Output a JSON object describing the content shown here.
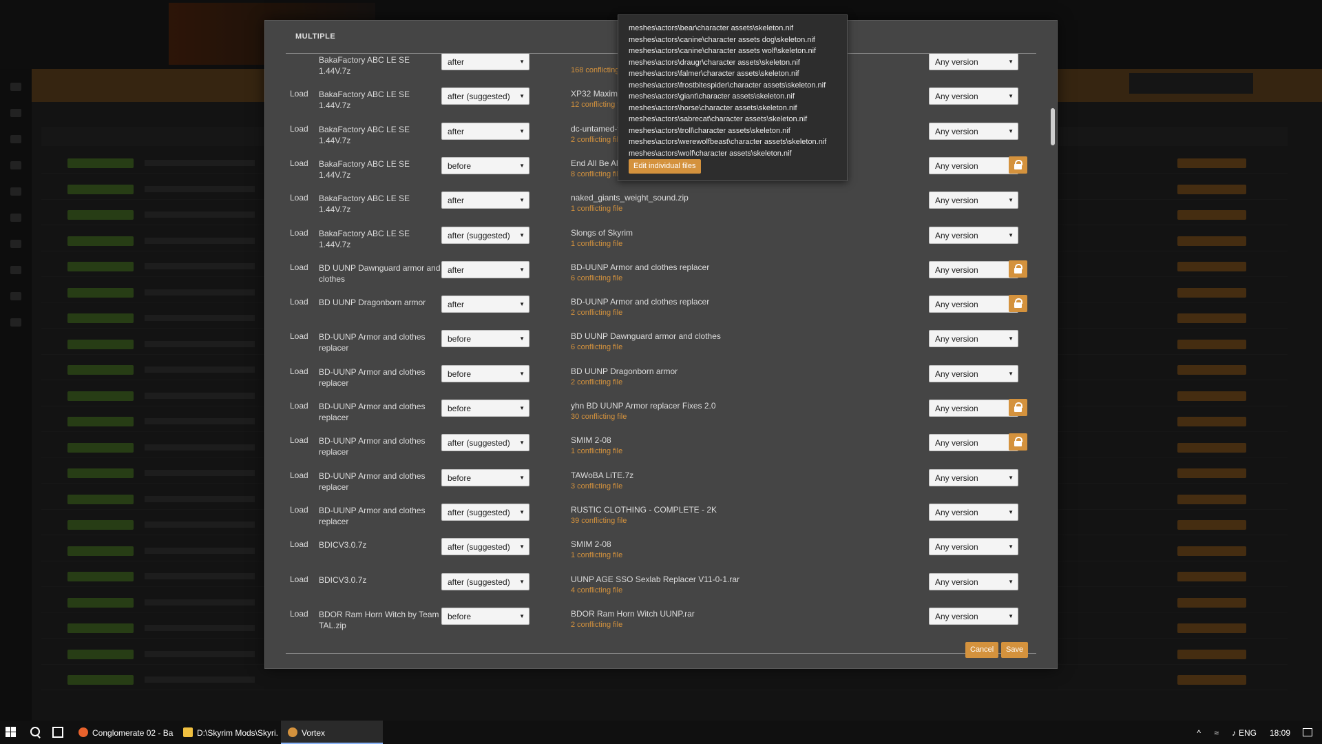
{
  "dialog": {
    "title": "MULTIPLE",
    "cancel_label": "Cancel",
    "save_label": "Save"
  },
  "popover": {
    "files": [
      "meshes\\actors\\bear\\character assets\\skeleton.nif",
      "meshes\\actors\\canine\\character assets dog\\skeleton.nif",
      "meshes\\actors\\canine\\character assets wolf\\skeleton.nif",
      "meshes\\actors\\draugr\\character assets\\skeleton.nif",
      "meshes\\actors\\falmer\\character assets\\skeleton.nif",
      "meshes\\actors\\frostbitespider\\character assets\\skeleton.nif",
      "meshes\\actors\\giant\\character assets\\skeleton.nif",
      "meshes\\actors\\horse\\character assets\\skeleton.nif",
      "meshes\\actors\\sabrecat\\character assets\\skeleton.nif",
      "meshes\\actors\\troll\\character assets\\skeleton.nif",
      "meshes\\actors\\werewolfbeast\\character assets\\skeleton.nif",
      "meshes\\actors\\wolf\\character assets\\skeleton.nif"
    ],
    "edit_label": "Edit individual files"
  },
  "rules": [
    {
      "type": "",
      "source": "BakaFactory ABC LE SE 1.44V.7z",
      "relation": "after",
      "target": "",
      "count": "168 conflicting file",
      "version": "Any version",
      "locked": false
    },
    {
      "type": "Load",
      "source": "BakaFactory ABC LE SE 1.44V.7z",
      "relation": "after (suggested)",
      "target": "XP32 Maximum Sk",
      "count": "12 conflicting file",
      "version": "Any version",
      "locked": false
    },
    {
      "type": "Load",
      "source": "BakaFactory ABC LE SE 1.44V.7z",
      "relation": "after",
      "target": "dc-untamed-v124.z",
      "count": "2 conflicting file",
      "version": "Any version",
      "locked": false
    },
    {
      "type": "Load",
      "source": "BakaFactory ABC LE SE 1.44V.7z",
      "relation": "before",
      "target": "End All Be All - Riek",
      "count": "8 conflicting file",
      "version": "Any version",
      "locked": true
    },
    {
      "type": "Load",
      "source": "BakaFactory ABC LE SE 1.44V.7z",
      "relation": "after",
      "target": "naked_giants_weight_sound.zip",
      "count": "1 conflicting file",
      "version": "Any version",
      "locked": false
    },
    {
      "type": "Load",
      "source": "BakaFactory ABC LE SE 1.44V.7z",
      "relation": "after (suggested)",
      "target": "Slongs of Skyrim",
      "count": "1 conflicting file",
      "version": "Any version",
      "locked": false
    },
    {
      "type": "Load",
      "source": "BD UUNP Dawnguard armor and clothes",
      "relation": "after",
      "target": "BD-UUNP Armor and clothes replacer",
      "count": "6 conflicting file",
      "version": "Any version",
      "locked": true
    },
    {
      "type": "Load",
      "source": "BD UUNP Dragonborn armor",
      "relation": "after",
      "target": "BD-UUNP Armor and clothes replacer",
      "count": "2 conflicting file",
      "version": "Any version",
      "locked": true
    },
    {
      "type": "Load",
      "source": "BD-UUNP Armor and clothes replacer",
      "relation": "before",
      "target": "BD UUNP Dawnguard armor and clothes",
      "count": "6 conflicting file",
      "version": "Any version",
      "locked": false
    },
    {
      "type": "Load",
      "source": "BD-UUNP Armor and clothes replacer",
      "relation": "before",
      "target": "BD UUNP Dragonborn armor",
      "count": "2 conflicting file",
      "version": "Any version",
      "locked": false
    },
    {
      "type": "Load",
      "source": "BD-UUNP Armor and clothes replacer",
      "relation": "before",
      "target": "yhn BD UUNP Armor replacer Fixes 2.0",
      "count": "30 conflicting file",
      "version": "Any version",
      "locked": true
    },
    {
      "type": "Load",
      "source": "BD-UUNP Armor and clothes replacer",
      "relation": "after (suggested)",
      "target": "SMIM 2-08",
      "count": "1 conflicting file",
      "version": "Any version",
      "locked": true
    },
    {
      "type": "Load",
      "source": "BD-UUNP Armor and clothes replacer",
      "relation": "before",
      "target": "TAWoBA LiTE.7z",
      "count": "3 conflicting file",
      "version": "Any version",
      "locked": false
    },
    {
      "type": "Load",
      "source": "BD-UUNP Armor and clothes replacer",
      "relation": "after (suggested)",
      "target": "RUSTIC CLOTHING - COMPLETE - 2K",
      "count": "39 conflicting file",
      "version": "Any version",
      "locked": false
    },
    {
      "type": "Load",
      "source": "BDICV3.0.7z",
      "relation": "after (suggested)",
      "target": "SMIM 2-08",
      "count": "1 conflicting file",
      "version": "Any version",
      "locked": false
    },
    {
      "type": "Load",
      "source": "BDICV3.0.7z",
      "relation": "after (suggested)",
      "target": "UUNP AGE SSO Sexlab Replacer V11-0-1.rar",
      "count": "4 conflicting file",
      "version": "Any version",
      "locked": false
    },
    {
      "type": "Load",
      "source": "BDOR Ram Horn Witch by Team TAL.zip",
      "relation": "before",
      "target": "BDOR Ram Horn Witch UUNP.rar",
      "count": "2 conflicting file",
      "version": "Any version",
      "locked": false
    }
  ],
  "taskbar": {
    "apps": [
      {
        "label": "Conglomerate 02 - Ba...",
        "icon": "firefox-icon",
        "color": "#e8622c"
      },
      {
        "label": "D:\\Skyrim Mods\\Skyri...",
        "icon": "folder-icon",
        "color": "#f0c040"
      },
      {
        "label": "Vortex",
        "icon": "vortex-icon",
        "color": "#d4923d"
      }
    ],
    "tray": {
      "chevron": "^",
      "lang": "ENG",
      "time": "18:09"
    }
  }
}
